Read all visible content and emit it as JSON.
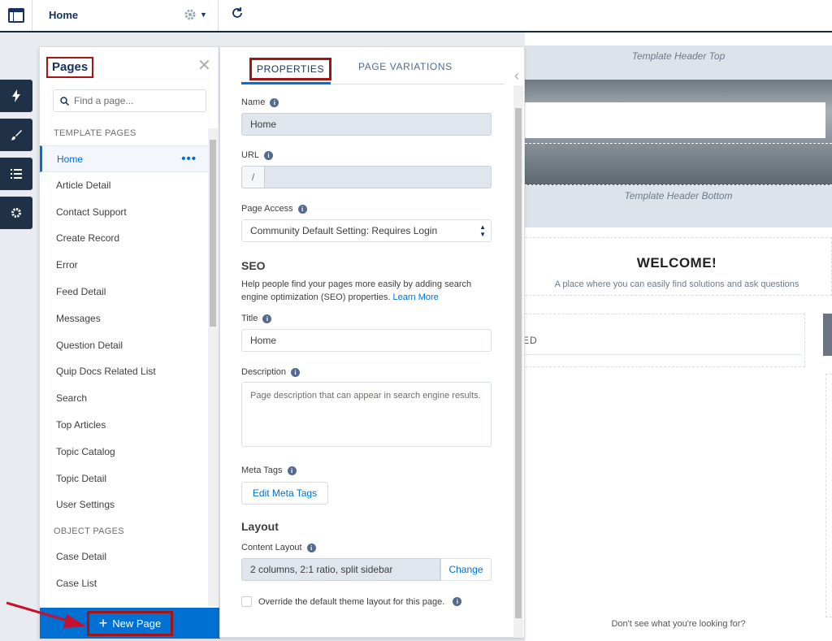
{
  "topbar": {
    "title": "Home",
    "gear_icon": "gear-icon",
    "refresh_icon": "refresh-icon"
  },
  "rail": [
    {
      "icon": "lightning-icon"
    },
    {
      "icon": "brush-icon"
    },
    {
      "icon": "list-icon"
    },
    {
      "icon": "gear-icon"
    }
  ],
  "pages_panel": {
    "title": "Pages",
    "search_placeholder": "Find a page...",
    "template_header": "TEMPLATE PAGES",
    "template_pages": [
      "Home",
      "Article Detail",
      "Contact Support",
      "Create Record",
      "Error",
      "Feed Detail",
      "Messages",
      "Question Detail",
      "Quip Docs Related List",
      "Search",
      "Top Articles",
      "Topic Catalog",
      "Topic Detail",
      "User Settings"
    ],
    "object_header": "OBJECT PAGES",
    "object_pages": [
      "Case Detail",
      "Case List"
    ],
    "new_page_label": "New Page"
  },
  "props_panel": {
    "tab_properties": "PROPERTIES",
    "tab_variations": "PAGE VARIATIONS",
    "name_label": "Name",
    "name_value": "Home",
    "url_label": "URL",
    "url_prefix": "/",
    "access_label": "Page Access",
    "access_value": "Community Default Setting: Requires Login",
    "seo_heading": "SEO",
    "seo_help": "Help people find your pages more easily by adding search engine optimization (SEO) properties.",
    "learn_more": "Learn More",
    "title_label": "Title",
    "title_value": "Home",
    "desc_label": "Description",
    "desc_placeholder": "Page description that can appear in search engine results.",
    "meta_label": "Meta Tags",
    "meta_button": "Edit Meta Tags",
    "layout_heading": "Layout",
    "content_layout_label": "Content Layout",
    "content_layout_value": "2 columns, 2:1 ratio, split sidebar",
    "change_button": "Change",
    "override_label": "Override the default theme layout for this page."
  },
  "preview": {
    "header_top": "Template Header Top",
    "header_bottom": "Template Header Bottom",
    "welcome": "WELCOME!",
    "welcome_sub": "A place where you can easily find solutions and ask questions",
    "feed_label": "EED",
    "dont_see": "Don't see what you're looking for?"
  }
}
